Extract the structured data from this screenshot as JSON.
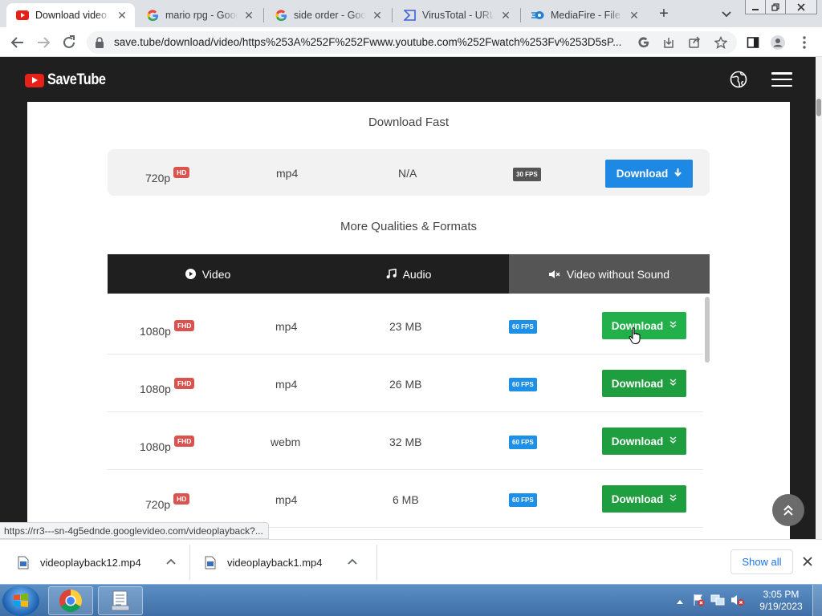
{
  "browser": {
    "tabs": [
      {
        "title": "Download video f",
        "icon": "youtube-icon",
        "active": true
      },
      {
        "title": "mario rpg - Goog",
        "icon": "google-icon",
        "active": false
      },
      {
        "title": "side order - Goog",
        "icon": "google-icon",
        "active": false
      },
      {
        "title": "VirusTotal - URL -",
        "icon": "virustotal-icon",
        "active": false
      },
      {
        "title": "MediaFire - File sh",
        "icon": "mediafire-icon",
        "active": false
      }
    ],
    "url": "save.tube/download/video/https%253A%252F%252Fwww.youtube.com%252Fwatch%253Fv%253D5sP..."
  },
  "site": {
    "logo_text": "SaveTube",
    "accent": "#e62117"
  },
  "download_fast": {
    "heading": "Download Fast",
    "quality": "720p",
    "badge": "HD",
    "format": "mp4",
    "size": "N/A",
    "fps": "30 FPS",
    "button_label": "Download"
  },
  "more": {
    "heading": "More Qualities & Formats",
    "tabs": [
      {
        "label": "Video",
        "icon": "play-circle-icon",
        "active": false
      },
      {
        "label": "Audio",
        "icon": "music-note-icon",
        "active": false
      },
      {
        "label": "Video without Sound",
        "icon": "muted-speaker-icon",
        "active": true
      }
    ],
    "rows": [
      {
        "quality": "1080p",
        "badge": "FHD",
        "format": "mp4",
        "size": "23 MB",
        "fps": "60 FPS",
        "button_label": "Download"
      },
      {
        "quality": "1080p",
        "badge": "FHD",
        "format": "mp4",
        "size": "26 MB",
        "fps": "60 FPS",
        "button_label": "Download"
      },
      {
        "quality": "1080p",
        "badge": "FHD",
        "format": "webm",
        "size": "32 MB",
        "fps": "60 FPS",
        "button_label": "Download"
      },
      {
        "quality": "720p",
        "badge": "HD",
        "format": "mp4",
        "size": "6 MB",
        "fps": "60 FPS",
        "button_label": "Download"
      }
    ]
  },
  "status_url": "https://rr3---sn-4g5ednde.googlevideo.com/videoplayback?...",
  "downloads": {
    "items": [
      {
        "name": "videoplayback12.mp4"
      },
      {
        "name": "videoplayback1.mp4"
      }
    ],
    "show_all_label": "Show all"
  },
  "taskbar": {
    "time": "3:05 PM",
    "date": "9/19/2023"
  },
  "colors": {
    "download_fast_button": "#1e88e5",
    "download_button": "#1e9e3f",
    "fhd_badge": "#d9534f",
    "fps_badge": "#1e90e6"
  }
}
